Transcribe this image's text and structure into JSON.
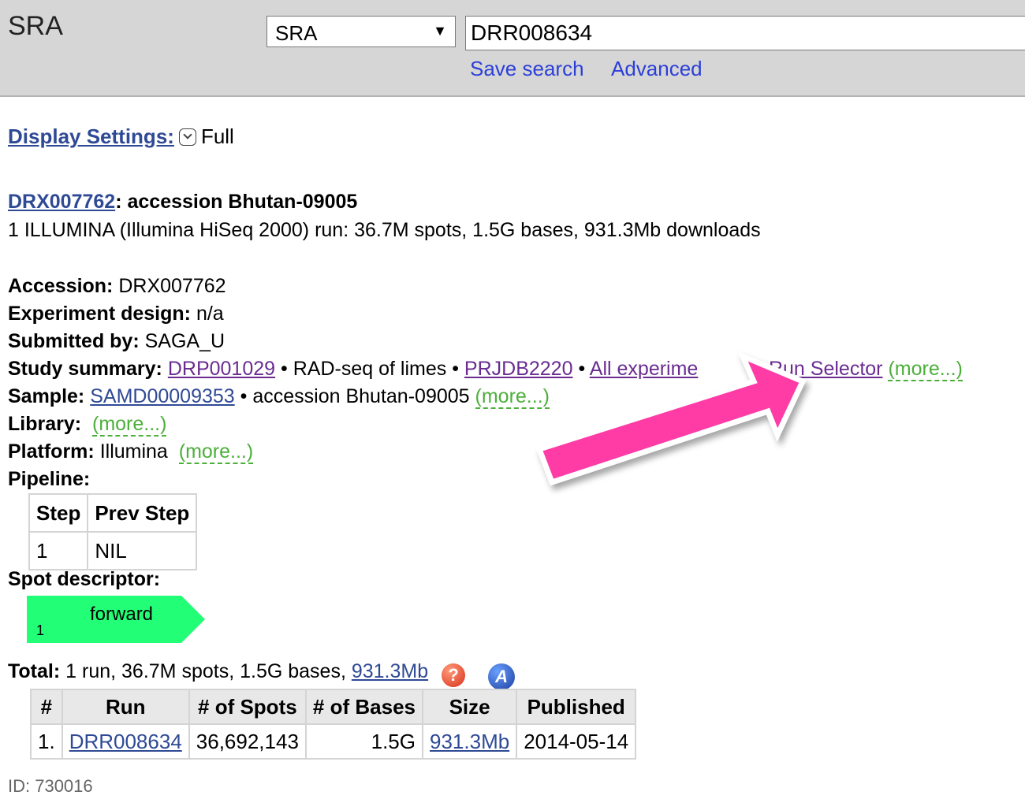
{
  "header": {
    "db_title": "SRA",
    "db_select_value": "SRA",
    "db_select_arrow": "▼",
    "search_value": "DRR008634",
    "save_search": "Save search",
    "advanced": "Advanced"
  },
  "display_settings": {
    "label": "Display Settings:",
    "value": "Full"
  },
  "record": {
    "accession_link": "DRX007762",
    "title_suffix": ": accession Bhutan-09005",
    "subtitle": "1 ILLUMINA (Illumina HiSeq 2000) run: 36.7M spots, 1.5G bases, 931.3Mb downloads"
  },
  "fields": {
    "accession_label": "Accession:",
    "accession_value": "DRX007762",
    "design_label": "Experiment design:",
    "design_value": "n/a",
    "submitted_label": "Submitted by:",
    "submitted_value": "SAGA_U",
    "study_label": "Study summary:",
    "study_link": "DRP001029",
    "sep": "•",
    "study_title": "RAD-seq of limes",
    "bioproject_link": "PRJDB2220",
    "all_experiments": "All experime",
    "run_selector": "Run Selector",
    "more": "(more...)",
    "sample_label": "Sample:",
    "sample_link": "SAMD00009353",
    "sample_title": "accession Bhutan-09005",
    "library_label": "Library:",
    "platform_label": "Platform:",
    "platform_value": "Illumina",
    "pipeline_label": "Pipeline:",
    "spot_label": "Spot descriptor:"
  },
  "pipeline": {
    "headers": [
      "Step",
      "Prev Step"
    ],
    "rows": [
      [
        "1",
        "NIL"
      ]
    ]
  },
  "spot_descriptor": {
    "read_label": "forward",
    "read_index": "1"
  },
  "total": {
    "label": "Total:",
    "text": "1 run, 36.7M spots, 1.5G bases,",
    "size_link": "931.3Mb",
    "help_glyph": "?",
    "analysis_glyph": "A"
  },
  "runs": {
    "headers": [
      "#",
      "Run",
      "# of Spots",
      "# of Bases",
      "Size",
      "Published"
    ],
    "rows": [
      {
        "n": "1.",
        "run": "DRR008634",
        "spots": "36,692,143",
        "bases": "1.5G",
        "size": "931.3Mb",
        "published": "2014-05-14"
      }
    ]
  },
  "footer": {
    "id": "ID: 730016"
  },
  "colors": {
    "header_bg": "#d6d6d6",
    "link": "#2f4a95",
    "link_header": "#2b3fd8",
    "visited": "#6a2c91",
    "more": "#4caf3a",
    "spot_read": "#22ff77",
    "arrow": "#ff3aa6"
  }
}
